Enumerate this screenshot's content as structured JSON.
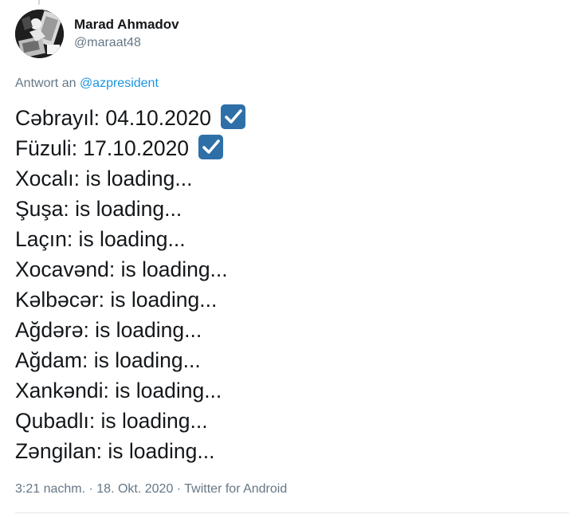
{
  "author": {
    "display_name": "Marad Ahmadov",
    "handle": "@maraat48",
    "avatar_icon": "avatar-photo"
  },
  "reply": {
    "prefix": "Antwort an",
    "mention": "@azpresident"
  },
  "tweet": {
    "lines": [
      {
        "text": "Cəbrayıl: 04.10.2020",
        "check": true
      },
      {
        "text": "Füzuli: 17.10.2020",
        "check": true
      },
      {
        "text": "Xocalı: is loading...",
        "check": false
      },
      {
        "text": "Şuşa: is loading...",
        "check": false
      },
      {
        "text": "Laçın: is loading...",
        "check": false
      },
      {
        "text": "Xocavənd: is loading...",
        "check": false
      },
      {
        "text": "Kəlbəcər: is loading...",
        "check": false
      },
      {
        "text": "Ağdərə: is loading...",
        "check": false
      },
      {
        "text": "Ağdam: is loading...",
        "check": false
      },
      {
        "text": "Xankəndi: is loading...",
        "check": false
      },
      {
        "text": "Qubadlı: is loading...",
        "check": false
      },
      {
        "text": "Zəngilan: is loading...",
        "check": false
      }
    ],
    "check_icon": "check-mark-button-emoji",
    "check_color": "#2f6fa8"
  },
  "meta": {
    "time": "3:21 nachm.",
    "date": "18. Okt. 2020",
    "source": "Twitter for Android",
    "separator": " · "
  },
  "colors": {
    "text": "#14171a",
    "secondary": "#657786",
    "link": "#1b95e0"
  }
}
